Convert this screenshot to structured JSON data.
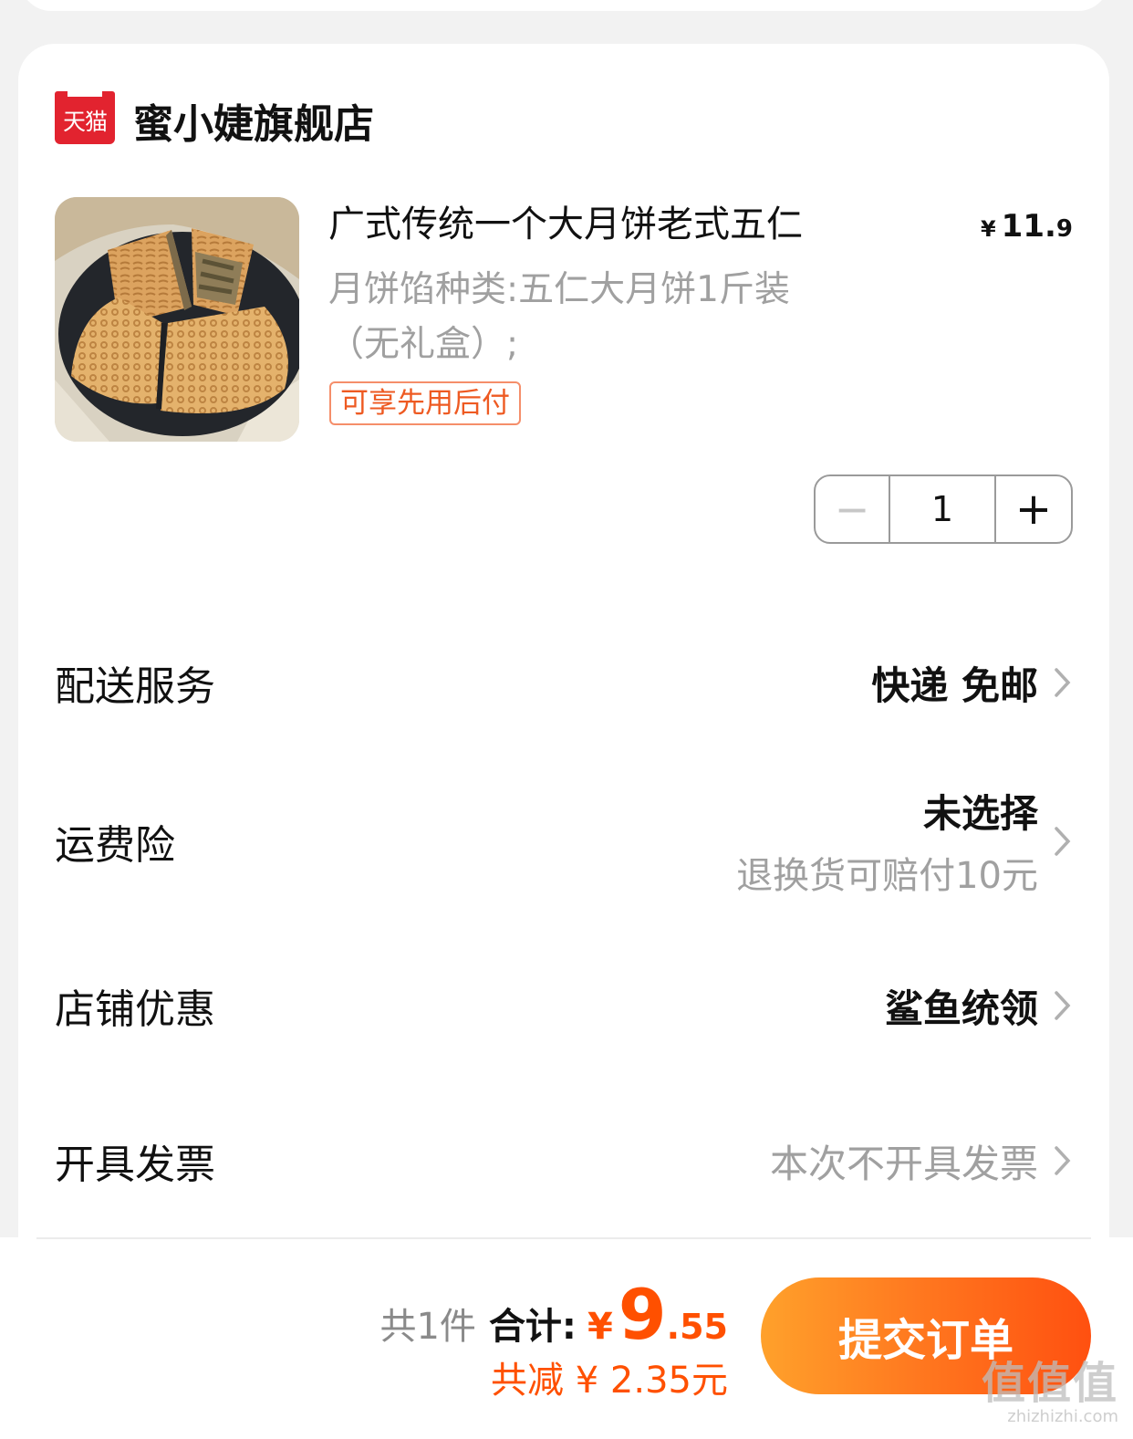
{
  "store": {
    "badge": "天猫",
    "name": "蜜小婕旗舰店"
  },
  "product": {
    "image_alt": "mooncake-product-image",
    "title": "广式传统一个大月饼老式五仁",
    "price_symbol": "¥",
    "price_int": "11.",
    "price_dec": "9",
    "spec_line1": "月饼馅种类:五仁大月饼1斤装",
    "spec_line2": "（无礼盒）;",
    "tag": "可享先用后付",
    "quantity": "1",
    "minus": "−",
    "plus": "+"
  },
  "rows": {
    "delivery": {
      "label": "配送服务",
      "value": "快递 免邮"
    },
    "insurance": {
      "label": "运费险",
      "value": "未选择",
      "sub": "退换货可赔付10元"
    },
    "discount": {
      "label": "店铺优惠",
      "value": "鲨鱼统领"
    },
    "invoice": {
      "label": "开具发票",
      "value": "本次不开具发票"
    }
  },
  "footer": {
    "count": "共1件",
    "total_label": "合计:",
    "total_symbol": "¥",
    "total_int": "9",
    "total_dec": ".55",
    "discount_text": "共减 ¥ 2.35元",
    "submit": "提交订单"
  },
  "watermark": {
    "main": "值值值",
    "sub": "zhizhizhi.com"
  },
  "colors": {
    "accent": "#ff5000",
    "tmall": "#e2232f",
    "muted": "#a0a0a0"
  }
}
